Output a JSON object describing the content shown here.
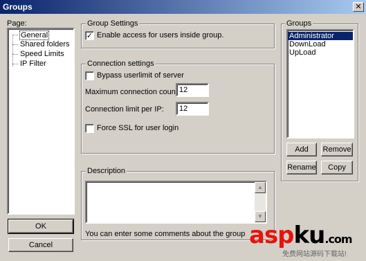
{
  "window": {
    "title": "Groups",
    "close_glyph": "✕"
  },
  "page_panel": {
    "label": "Page:",
    "items": [
      "General",
      "Shared folders",
      "Speed Limits",
      "IP Filter"
    ]
  },
  "group_settings": {
    "title": "Group Settings",
    "enable_access": {
      "label": "Enable access for users inside group.",
      "checked": true,
      "glyph": "✓"
    }
  },
  "connection_settings": {
    "title": "Connection settings",
    "bypass_userlimit": {
      "label": "Bypass userlimit of server",
      "checked": false
    },
    "max_connection_count": {
      "label": "Maximum connection count:",
      "value": "12"
    },
    "connection_limit_per_ip": {
      "label": "Connection limit per IP:",
      "value": "12"
    },
    "force_ssl": {
      "label": "Force SSL for user login",
      "checked": false
    }
  },
  "description": {
    "title": "Description",
    "value": "",
    "hint": "You can enter some comments about the group"
  },
  "groups_panel": {
    "title": "Groups",
    "items": [
      "Administrator",
      "DownLoad",
      "UpLoad"
    ],
    "selected": "Administrator",
    "buttons": {
      "add": "Add",
      "remove": "Remove",
      "rename": "Rename",
      "copy": "Copy"
    }
  },
  "footer_buttons": {
    "ok": "OK",
    "cancel": "Cancel"
  },
  "watermark": {
    "brand_red": "asp",
    "brand_black": "ku",
    "brand_com": ".com",
    "subtitle": "免费网站源码下载站!"
  },
  "colors": {
    "titlebar": "#0a246a",
    "face": "#d4d0c8",
    "selection": "#0a246a",
    "watermark_red": "#e8120c"
  }
}
